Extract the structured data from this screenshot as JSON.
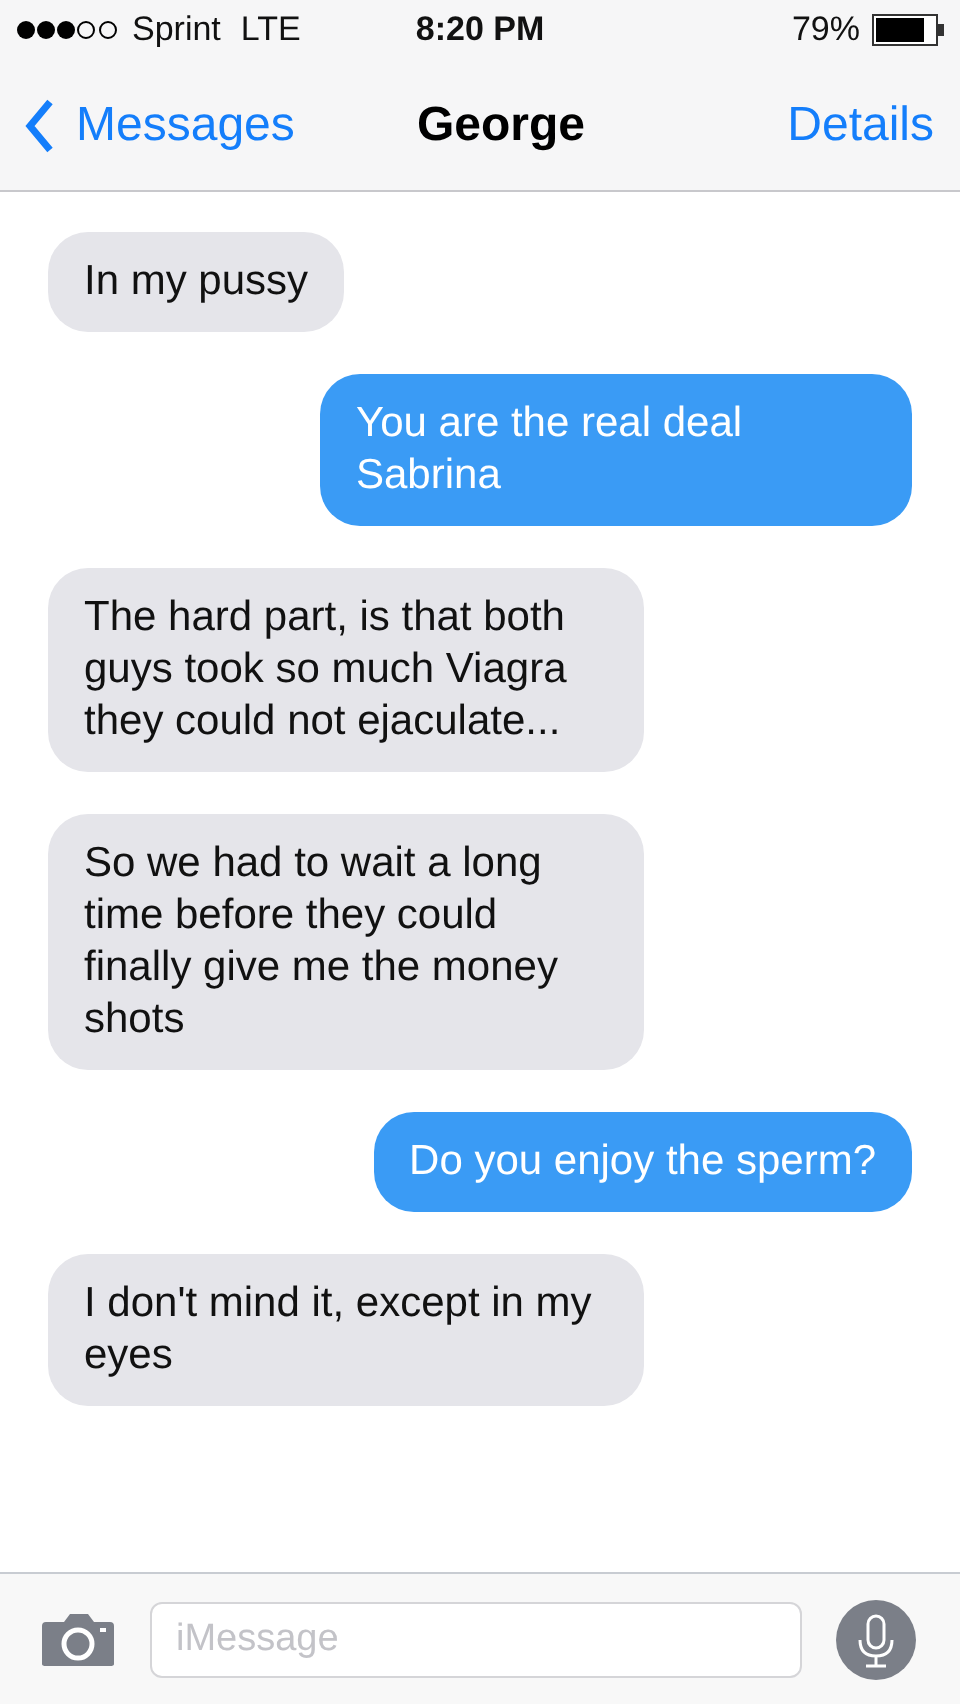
{
  "status_bar": {
    "carrier": "Sprint",
    "network": "LTE",
    "time": "8:20 PM",
    "battery": "79%"
  },
  "nav": {
    "back": "Messages",
    "title": "George",
    "action": "Details"
  },
  "messages": [
    {
      "kind": "received",
      "text": "In my pussy"
    },
    {
      "kind": "sent",
      "text": "You are the real deal Sabrina"
    },
    {
      "kind": "received",
      "text": "The hard part, is that both guys took so much Viagra they could not ejaculate..."
    },
    {
      "kind": "received",
      "text": "So we had to wait a long time before they could finally give me the money shots"
    },
    {
      "kind": "sent",
      "text": "Do you enjoy the sperm?"
    },
    {
      "kind": "received",
      "text": "I don't mind it, except in my eyes"
    }
  ],
  "composer": {
    "placeholder": "iMessage"
  }
}
